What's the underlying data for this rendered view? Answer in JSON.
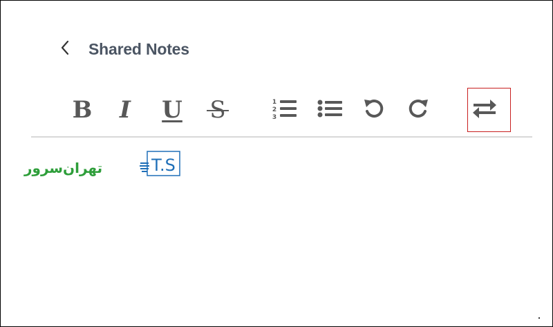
{
  "header": {
    "back_icon": "chevron-left-icon",
    "title": "Shared Notes"
  },
  "toolbar": {
    "bold_label": "B",
    "italic_label": "I",
    "underline_label": "U",
    "strikethrough_label": "S",
    "ordered_list_icon": "ordered-list-icon",
    "ordered_list_numbers": [
      "1",
      "2",
      "3"
    ],
    "bullet_list_icon": "bullet-list-icon",
    "undo_icon": "undo-icon",
    "redo_icon": "redo-icon",
    "swap_icon": "swap-direction-icon",
    "highlighted_item": "swap-direction"
  },
  "watermark": {
    "logo_text": "T.S",
    "script_text": "تهران‌سرور"
  },
  "colors": {
    "text_gray": "#585858",
    "title_gray": "#4b5563",
    "highlight_red": "#c81e1e",
    "divider": "#d8d8d8",
    "logo_blue": "#1e6fb8",
    "logo_green": "#2e9e3a"
  }
}
